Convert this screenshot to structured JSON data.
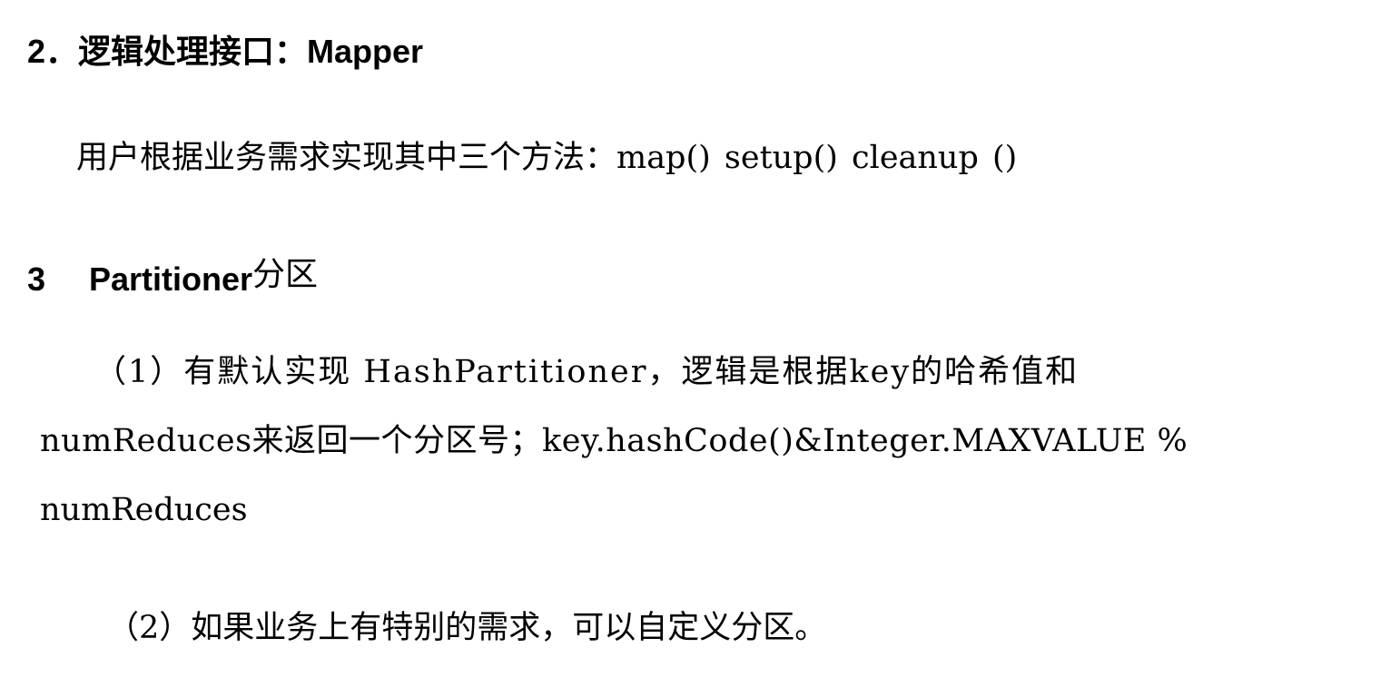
{
  "section_mapper": {
    "heading": "2．逻辑处理接口：Mapper",
    "methods_line": "用户根据业务需求实现其中三个方法：map()   setup()   cleanup ()"
  },
  "section_partitioner": {
    "heading_number": "3",
    "heading_title": "Partitioner",
    "heading_suffix": "分区",
    "default_impl_line1": "（1）有默认实现  HashPartitioner，逻辑是根据key的哈希值和",
    "default_impl_line2": "numReduces来返回一个分区号；key.hashCode()&Integer.MAXVALUE  %",
    "default_impl_line3": "numReduces",
    "custom_line": "（2）如果业务上有特别的需求，可以自定义分区。"
  }
}
